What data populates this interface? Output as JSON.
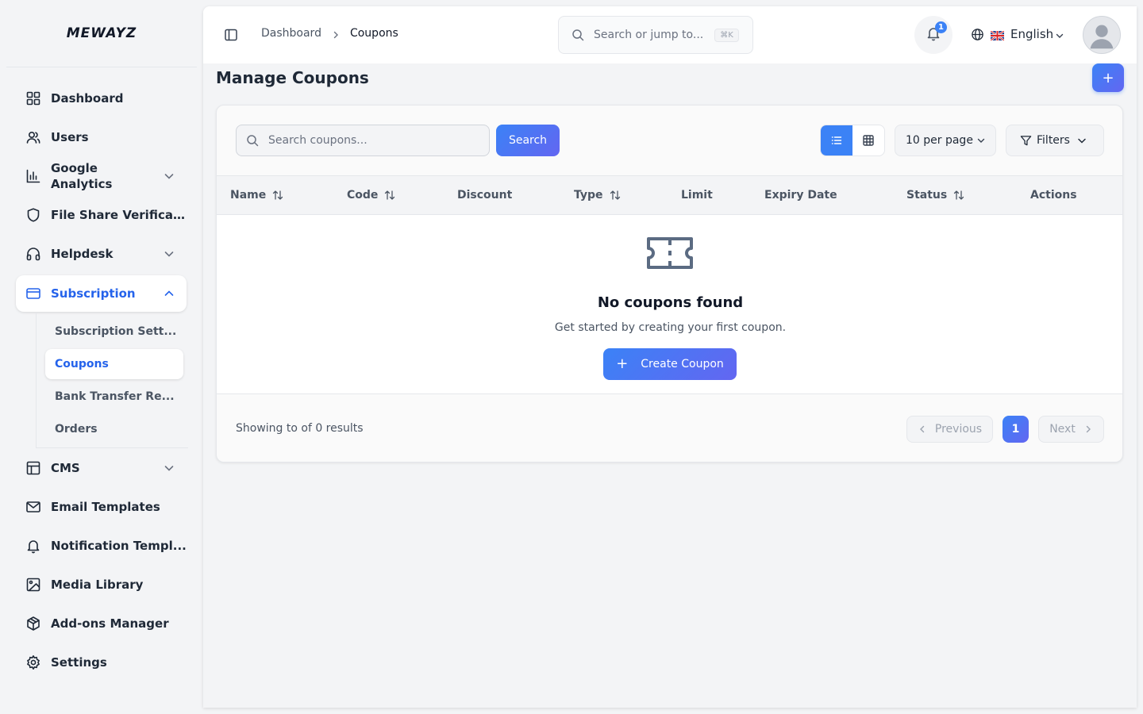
{
  "brand": {
    "logo_text": "MEWAYZ"
  },
  "sidebar": {
    "items": [
      {
        "label": "Dashboard",
        "icon": "dashboard-grid-icon"
      },
      {
        "label": "Users",
        "icon": "users-icon"
      },
      {
        "label": "Google Analytics",
        "icon": "bar-chart-icon",
        "expandable": true
      },
      {
        "label": "File Share Verifica...",
        "icon": "shield-icon"
      },
      {
        "label": "Helpdesk",
        "icon": "headphones-icon",
        "expandable": true
      },
      {
        "label": "Subscription",
        "icon": "credit-card-icon",
        "expandable": true,
        "expanded": true,
        "active": true
      },
      {
        "label": "CMS",
        "icon": "layout-icon",
        "expandable": true
      },
      {
        "label": "Email Templates",
        "icon": "mail-icon"
      },
      {
        "label": "Notification Templ...",
        "icon": "bell-icon"
      },
      {
        "label": "Media Library",
        "icon": "image-icon"
      },
      {
        "label": "Add-ons Manager",
        "icon": "package-icon"
      },
      {
        "label": "Settings",
        "icon": "gear-icon"
      }
    ],
    "subscription_children": [
      {
        "label": "Subscription Sett..."
      },
      {
        "label": "Coupons",
        "active": true
      },
      {
        "label": "Bank Transfer Re..."
      },
      {
        "label": "Orders"
      }
    ]
  },
  "topbar": {
    "breadcrumb": [
      "Dashboard",
      "Coupons"
    ],
    "search_placeholder": "Search or jump to...",
    "search_shortcut": "⌘K",
    "notification_count": "1",
    "language": "English"
  },
  "page": {
    "title": "Manage Coupons",
    "add_label": "+"
  },
  "toolbar": {
    "search_placeholder": "Search coupons...",
    "search_button": "Search",
    "per_page": "10 per page",
    "filters": "Filters"
  },
  "table": {
    "columns": [
      {
        "label": "Name",
        "sortable": true
      },
      {
        "label": "Code",
        "sortable": true
      },
      {
        "label": "Discount",
        "sortable": false
      },
      {
        "label": "Type",
        "sortable": true
      },
      {
        "label": "Limit",
        "sortable": false
      },
      {
        "label": "Expiry Date",
        "sortable": false
      },
      {
        "label": "Status",
        "sortable": true
      },
      {
        "label": "Actions",
        "sortable": false
      }
    ],
    "rows": []
  },
  "empty_state": {
    "icon": "ticket-icon",
    "title": "No coupons found",
    "subtitle": "Get started by creating your first coupon.",
    "button": "Create Coupon"
  },
  "pagination": {
    "summary": "Showing to of 0 results",
    "previous": "Previous",
    "current_page": "1",
    "next": "Next"
  },
  "colors": {
    "accent": "#3b82f6",
    "accent_gradient_end": "#6366f1",
    "active_text": "#2563eb"
  }
}
